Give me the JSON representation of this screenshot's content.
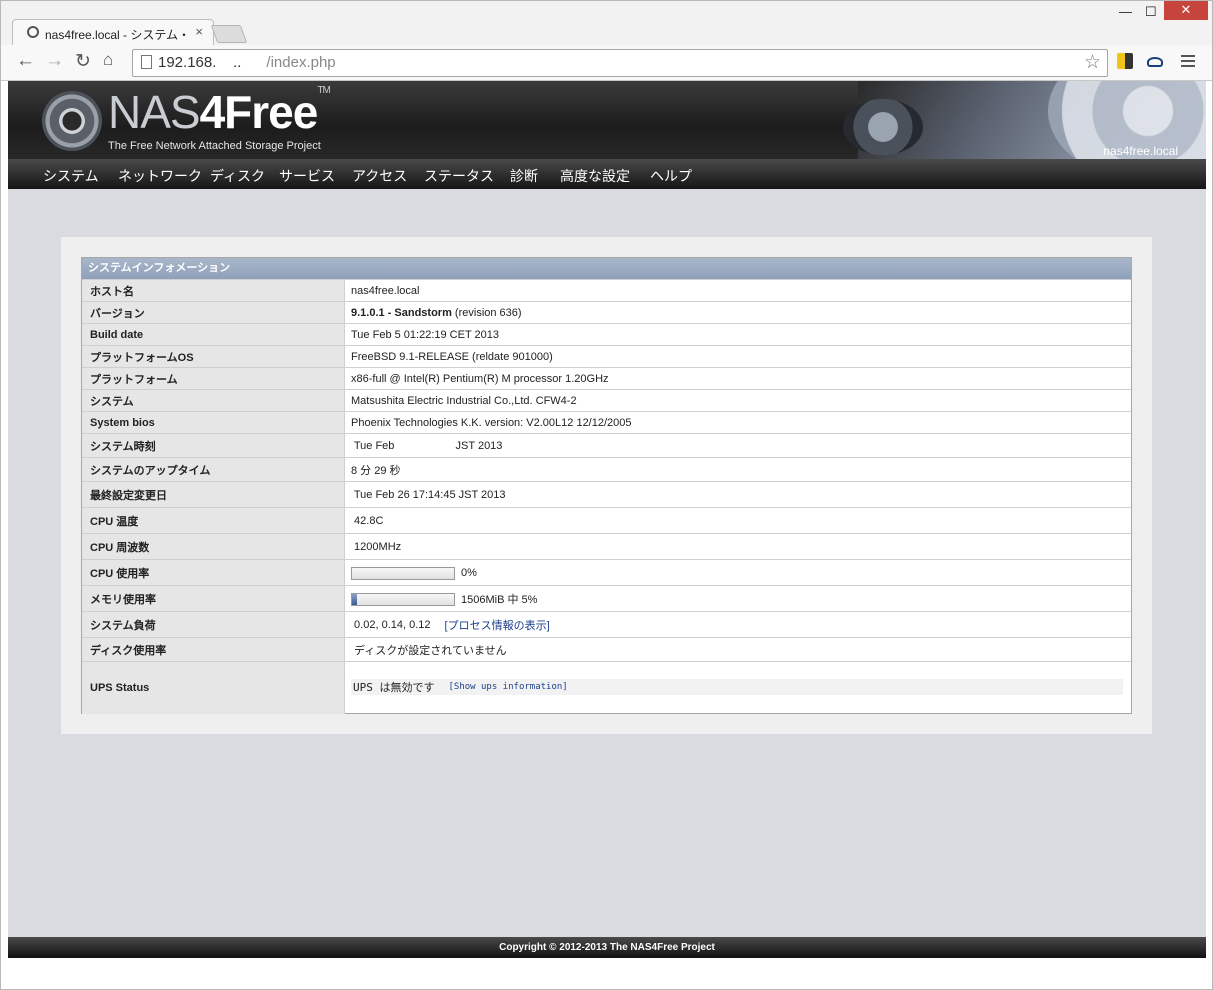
{
  "browser": {
    "tab_title": "nas4free.local - システム・",
    "tab_close": "×",
    "url_host": "192.168.    ..",
    "url_path": "      /index.php",
    "window_controls": {
      "minimize": "—",
      "maximize": "☐",
      "close": "✕"
    }
  },
  "header": {
    "logo_main": "NAS",
    "logo_accent": "4Free",
    "logo_tm": "TM",
    "logo_sub": "The Free Network Attached Storage Project",
    "hostname": "nas4free.local"
  },
  "nav": [
    "システム",
    "ネットワーク",
    "ディスク",
    "サービス",
    "アクセス",
    "ステータス",
    "診断",
    "高度な設定",
    "ヘルプ"
  ],
  "info": {
    "title": "システムインフォメーション",
    "rows": [
      {
        "label": "ホスト名",
        "value": "nas4free.local"
      },
      {
        "label": "バージョン",
        "value_bold": "9.1.0.1 - Sandstorm",
        "value": " (revision 636)"
      },
      {
        "label": "Build date",
        "value": "Tue Feb 5 01:22:19 CET 2013"
      },
      {
        "label": "プラットフォームOS",
        "value": "FreeBSD 9.1-RELEASE (reldate 901000)"
      },
      {
        "label": "プラットフォーム",
        "value": "x86-full @ Intel(R) Pentium(R) M processor 1.20GHz"
      },
      {
        "label": "システム",
        "value": "Matsushita Electric Industrial Co.,Ltd. CFW4-2"
      },
      {
        "label": "System bios",
        "value": "Phoenix Technologies K.K. version: V2.00L12 12/12/2005"
      },
      {
        "label": "システム時刻",
        "value": " Tue Feb                    JST 2013"
      },
      {
        "label": "システムのアップタイム",
        "value": "8 分 29 秒"
      },
      {
        "label": "最終設定変更日",
        "value": " Tue Feb 26 17:14:45 JST 2013"
      },
      {
        "label": "CPU 温度",
        "value": " 42.8C"
      },
      {
        "label": "CPU 周波数",
        "value": " 1200MHz"
      },
      {
        "label": "CPU 使用率",
        "value": "0%",
        "usage": 0.0
      },
      {
        "label": "メモリ使用率",
        "value": "1506MiB 中 5%",
        "usage": 0.05
      },
      {
        "label": "システム負荷",
        "value": " 0.02, 0.14, 0.12",
        "link": "[プロセス情報の表示]"
      },
      {
        "label": "ディスク使用率",
        "value": " ディスクが設定されていません"
      },
      {
        "label": "UPS Status",
        "value": "UPS は無効です",
        "link": "[Show ups information]"
      }
    ]
  },
  "footer": "Copyright © 2012-2013 The NAS4Free Project"
}
